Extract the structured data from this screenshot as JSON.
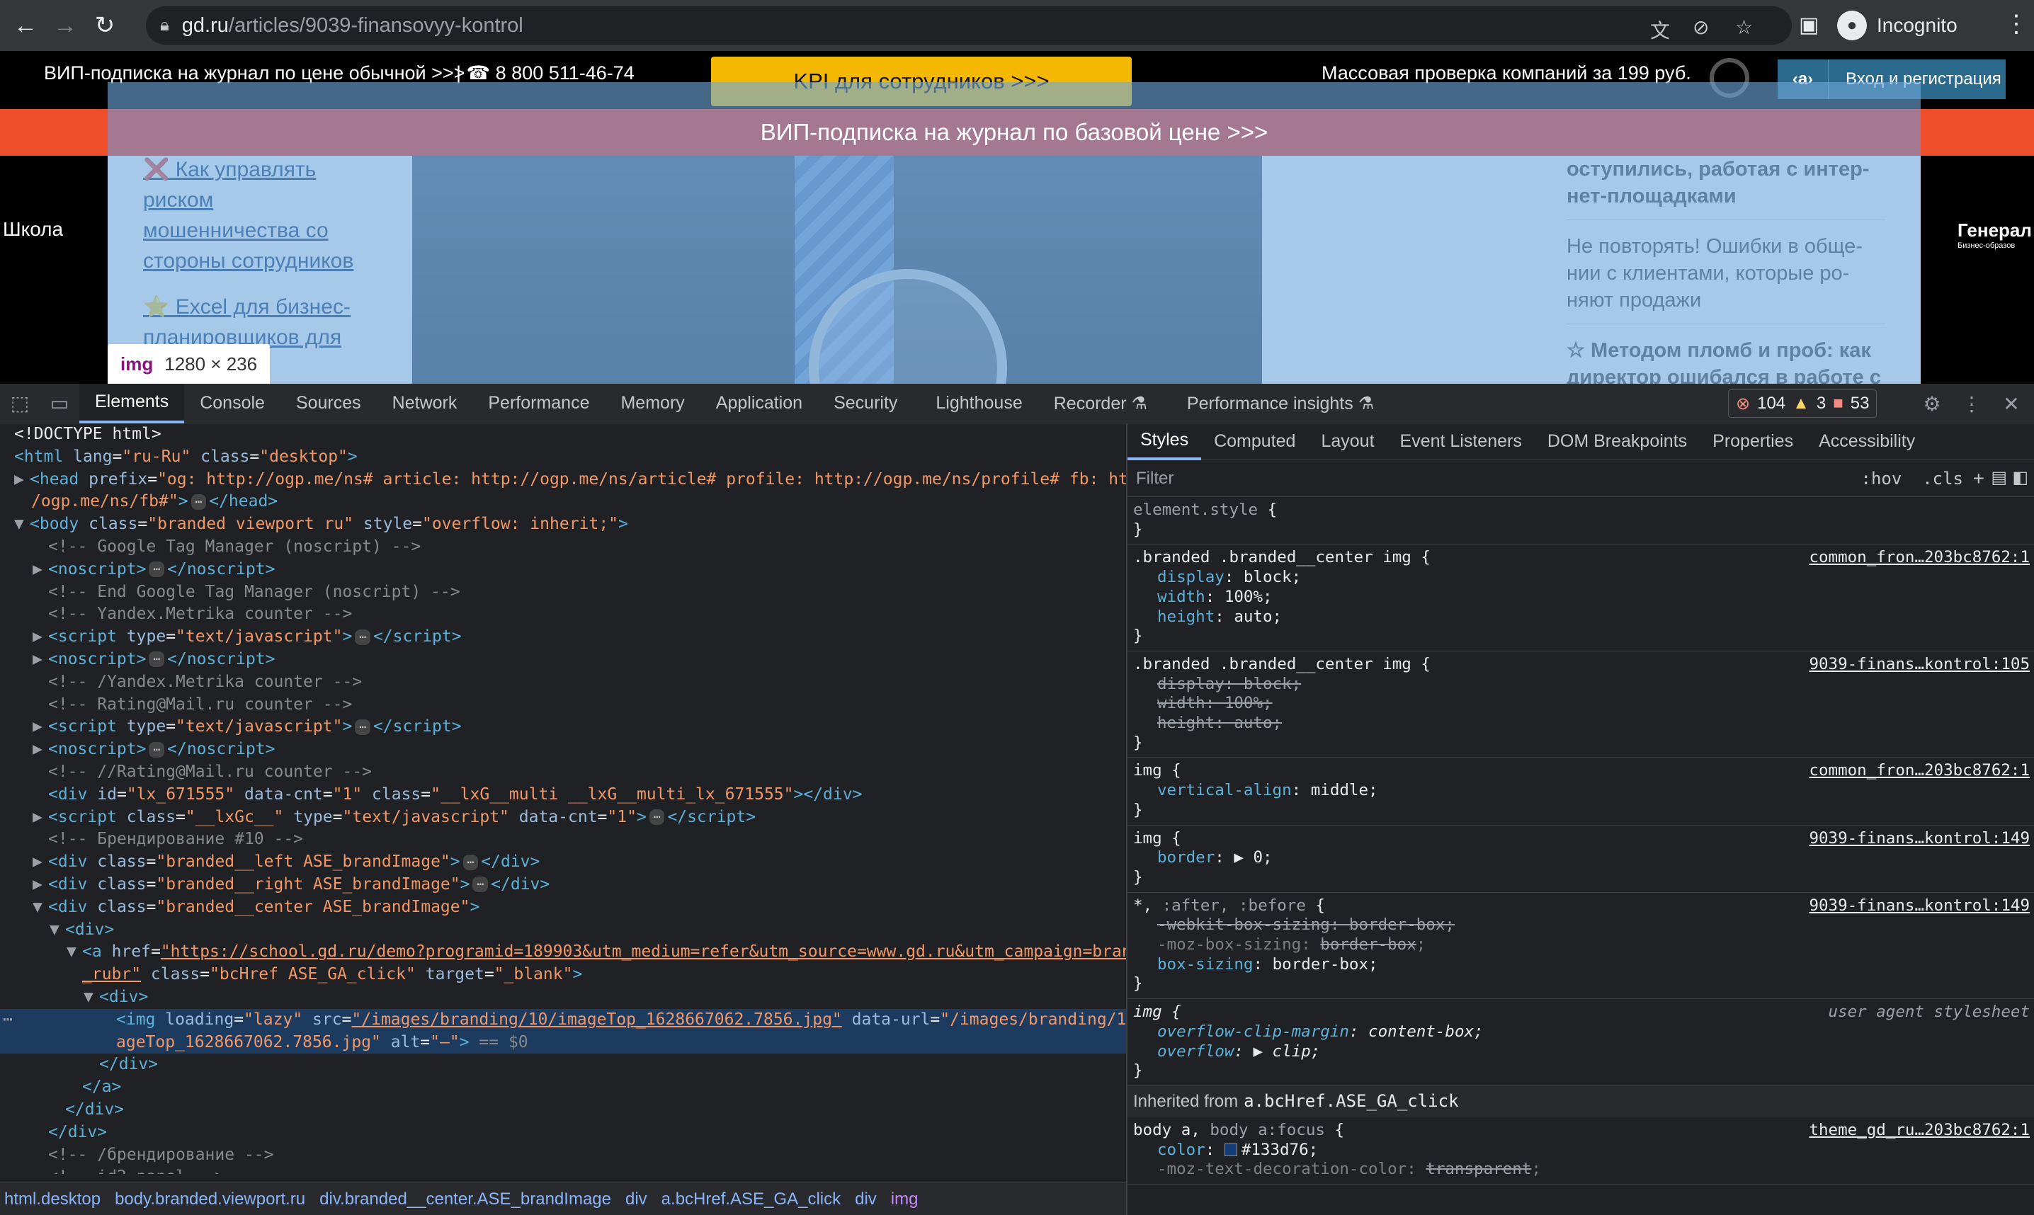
{
  "browser": {
    "url_host": "gd.ru",
    "url_path": "/articles/9039-finansovyy-kontrol",
    "profile": "Incognito"
  },
  "page": {
    "top_left": "ВИП-подписка на журнал по цене обычной >>>",
    "phone": "| ☎ 8 800 511-46-74",
    "kpi": "KPI для сотрудников >>>",
    "mass_check": "Массовая проверка компаний за 199 руб.",
    "login_badge": "‹a›",
    "login": "Вход и регистрация",
    "vip_band": "ВИП-подписка на журнал по базовой цене >>>",
    "brand_left": "Школа",
    "brand_right": "Генерал",
    "brand_right_sub": "Бизнес-образов",
    "left_links": [
      "❌ Как управлять риском мошенничества со стороны сотрудников",
      "⭐ Excel для бизнес-планировщиков для"
    ],
    "right_items": [
      "оступились, работая с интер-нет-площадками",
      "Не повторять! Ошибки в обще-нии с клиентами, которые ро-няют продажи",
      "☆ Методом пломб и проб: как директор ошибался в работе с"
    ],
    "tooltip_tag": "img",
    "tooltip_size": "1280 × 236"
  },
  "devtools": {
    "tabs": [
      "Elements",
      "Console",
      "Sources",
      "Network",
      "Performance",
      "Memory",
      "Application",
      "Security",
      "Lighthouse",
      "Recorder ⚗",
      "Performance insights ⚗"
    ],
    "errors": "104",
    "warnings": "3",
    "messages": "53",
    "side_tabs": [
      "Styles",
      "Computed",
      "Layout",
      "Event Listeners",
      "DOM Breakpoints",
      "Properties",
      "Accessibility"
    ],
    "filter_placeholder": "Filter",
    "hov": ":hov",
    ".cls": ".cls",
    "breadcrumbs": [
      "html.desktop",
      "body.branded.viewport.ru",
      "div.branded__center.ASE_brandImage",
      "div",
      "a.bcHref.ASE_GA_click",
      "div",
      "img"
    ],
    "inherited_label": "Inherited from",
    "inherited_from": "a.bcHref.ASE_GA_click"
  }
}
